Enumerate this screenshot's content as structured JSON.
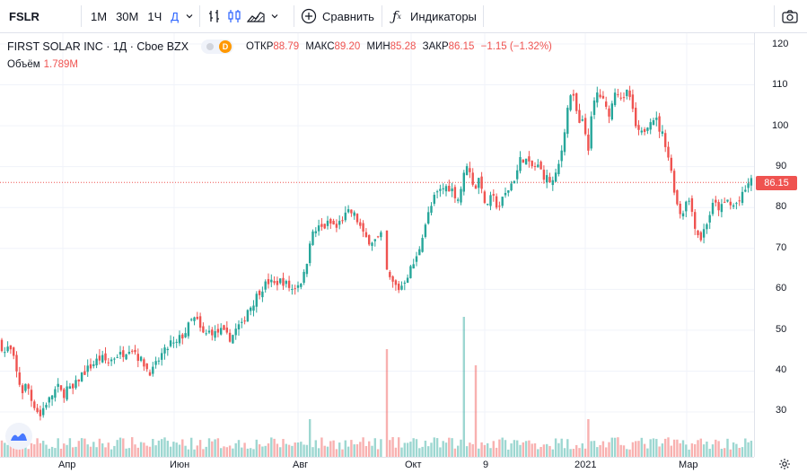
{
  "toolbar": {
    "symbol": "FSLR",
    "intervals": [
      "1M",
      "30M",
      "1Ч",
      "Д"
    ],
    "active_interval": "Д",
    "compare_label": "Сравнить",
    "indicators_label": "Индикаторы"
  },
  "legend": {
    "title": "FIRST SOLAR INC · 1Д · Cboe BZX",
    "badge": "D",
    "open_label": "ОТКР",
    "open": "88.79",
    "high_label": "МАКС",
    "high": "89.20",
    "low_label": "МИН",
    "low": "85.28",
    "close_label": "ЗАКР",
    "close": "86.15",
    "change": "−1.15 (−1.32%)",
    "volume_label": "Объём",
    "volume": "1.789M"
  },
  "price_scale": {
    "ticks": [
      "120",
      "110",
      "100",
      "90",
      "80",
      "70",
      "60",
      "50",
      "40",
      "30"
    ],
    "last_price": "86.15"
  },
  "time_scale": {
    "labels": [
      "Апр",
      "Июн",
      "Авг",
      "Окт",
      "9",
      "2021",
      "Мар"
    ]
  },
  "colors": {
    "up": "#26a69a",
    "down": "#ef5350",
    "accent": "#2962ff",
    "grid": "#f0f3fa"
  },
  "chart_data": {
    "type": "candlestick",
    "title": "FIRST SOLAR INC · 1Д · Cboe BZX",
    "ylim": [
      22,
      123
    ],
    "close_path": [
      [
        0,
        47
      ],
      [
        5,
        44.5
      ],
      [
        10,
        46
      ],
      [
        15,
        43
      ],
      [
        20,
        38
      ],
      [
        25,
        35
      ],
      [
        30,
        37
      ],
      [
        35,
        33
      ],
      [
        40,
        31
      ],
      [
        45,
        29
      ],
      [
        50,
        32
      ],
      [
        55,
        33
      ],
      [
        60,
        35
      ],
      [
        65,
        36
      ],
      [
        70,
        34
      ],
      [
        75,
        36
      ],
      [
        80,
        35
      ],
      [
        85,
        37
      ],
      [
        90,
        39
      ],
      [
        95,
        40
      ],
      [
        100,
        41
      ],
      [
        105,
        42
      ],
      [
        110,
        43
      ],
      [
        115,
        43
      ],
      [
        120,
        42
      ],
      [
        125,
        43
      ],
      [
        130,
        44
      ],
      [
        135,
        44
      ],
      [
        140,
        45
      ],
      [
        145,
        46
      ],
      [
        150,
        45
      ],
      [
        155,
        43
      ],
      [
        160,
        42
      ],
      [
        165,
        40
      ],
      [
        170,
        40
      ],
      [
        175,
        42
      ],
      [
        180,
        44
      ],
      [
        185,
        45
      ],
      [
        190,
        47
      ],
      [
        195,
        46
      ],
      [
        200,
        48
      ],
      [
        205,
        49
      ],
      [
        210,
        51
      ],
      [
        215,
        53
      ],
      [
        220,
        52
      ],
      [
        225,
        49
      ],
      [
        230,
        49
      ],
      [
        235,
        50
      ],
      [
        240,
        49
      ],
      [
        245,
        50
      ],
      [
        250,
        49
      ],
      [
        255,
        48
      ],
      [
        260,
        49
      ],
      [
        265,
        51
      ],
      [
        270,
        51
      ],
      [
        275,
        55
      ],
      [
        280,
        56
      ],
      [
        285,
        58
      ],
      [
        290,
        60
      ],
      [
        295,
        61
      ],
      [
        300,
        62
      ],
      [
        305,
        61
      ],
      [
        310,
        62
      ],
      [
        315,
        62
      ],
      [
        320,
        61
      ],
      [
        325,
        60
      ],
      [
        330,
        61
      ],
      [
        335,
        62
      ],
      [
        340,
        64
      ],
      [
        345,
        72
      ],
      [
        350,
        74
      ],
      [
        355,
        75
      ],
      [
        360,
        75
      ],
      [
        365,
        76
      ],
      [
        370,
        76
      ],
      [
        375,
        75
      ],
      [
        380,
        77
      ],
      [
        385,
        78
      ],
      [
        390,
        79
      ],
      [
        395,
        78
      ],
      [
        400,
        76
      ],
      [
        405,
        73
      ],
      [
        410,
        72
      ],
      [
        415,
        72
      ],
      [
        420,
        72
      ],
      [
        425,
        73
      ],
      [
        430,
        65
      ],
      [
        435,
        62
      ],
      [
        440,
        61
      ],
      [
        445,
        60
      ],
      [
        450,
        62
      ],
      [
        455,
        64
      ],
      [
        460,
        66
      ],
      [
        465,
        68
      ],
      [
        470,
        73
      ],
      [
        475,
        77
      ],
      [
        480,
        80
      ],
      [
        485,
        83
      ],
      [
        490,
        84
      ],
      [
        495,
        85
      ],
      [
        500,
        85
      ],
      [
        505,
        84
      ],
      [
        510,
        82
      ],
      [
        515,
        86
      ],
      [
        520,
        91
      ],
      [
        525,
        87
      ],
      [
        530,
        85
      ],
      [
        535,
        88
      ],
      [
        540,
        80
      ],
      [
        545,
        82
      ],
      [
        550,
        82
      ],
      [
        555,
        80
      ],
      [
        560,
        82
      ],
      [
        565,
        84
      ],
      [
        570,
        86
      ],
      [
        575,
        88
      ],
      [
        580,
        92
      ],
      [
        585,
        92
      ],
      [
        590,
        90
      ],
      [
        595,
        90
      ],
      [
        600,
        90
      ],
      [
        605,
        88
      ],
      [
        610,
        87
      ],
      [
        615,
        86
      ],
      [
        620,
        88
      ],
      [
        625,
        93
      ],
      [
        630,
        101
      ],
      [
        635,
        108
      ],
      [
        640,
        106
      ],
      [
        645,
        100
      ],
      [
        650,
        101
      ],
      [
        655,
        94
      ],
      [
        660,
        104
      ],
      [
        665,
        108
      ],
      [
        670,
        107
      ],
      [
        675,
        104
      ],
      [
        680,
        103
      ],
      [
        685,
        109
      ],
      [
        690,
        108
      ],
      [
        695,
        106
      ],
      [
        700,
        109
      ],
      [
        705,
        103
      ],
      [
        710,
        98
      ],
      [
        715,
        98
      ],
      [
        720,
        100
      ],
      [
        725,
        102
      ],
      [
        730,
        102
      ],
      [
        735,
        99
      ],
      [
        740,
        97
      ],
      [
        745,
        92
      ],
      [
        750,
        86
      ],
      [
        755,
        80
      ],
      [
        760,
        78
      ],
      [
        765,
        83
      ],
      [
        770,
        80
      ],
      [
        775,
        75
      ],
      [
        780,
        72
      ],
      [
        785,
        75
      ],
      [
        790,
        78
      ],
      [
        795,
        81
      ],
      [
        800,
        80
      ],
      [
        805,
        80
      ],
      [
        810,
        82
      ],
      [
        815,
        80
      ],
      [
        820,
        81
      ],
      [
        825,
        82
      ],
      [
        830,
        84
      ],
      [
        835,
        87
      ],
      [
        838,
        86
      ]
    ],
    "gaps": [
      [
        426,
        428
      ]
    ],
    "volume_spikes": [
      [
        430,
        40
      ],
      [
        517,
        46
      ],
      [
        531,
        37
      ],
      [
        655,
        30
      ],
      [
        345,
        30
      ]
    ]
  }
}
